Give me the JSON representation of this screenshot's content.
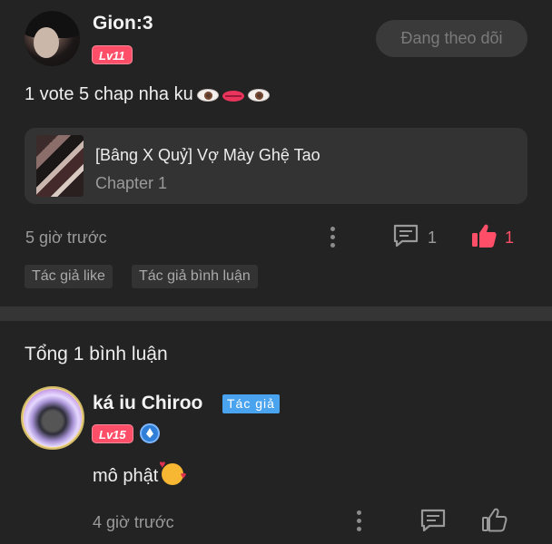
{
  "post": {
    "username": "Gion:3",
    "level": "Lv11",
    "follow_label": "Đang theo dõi",
    "text": "1 vote 5 chap nha ku",
    "emojis": [
      "eye-emoji",
      "lips-emoji",
      "eye-emoji"
    ],
    "card": {
      "title": "[Bâng X Quỷ] Vợ Mày Ghệ Tao",
      "subtitle": "Chapter 1"
    },
    "time": "5 giờ trước",
    "comment_count": "1",
    "like_count": "1",
    "tags": [
      "Tác giả like",
      "Tác giả bình luận"
    ]
  },
  "comments_section": {
    "total_label": "Tổng 1 bình luận",
    "comments": [
      {
        "name": "ká iu Chiroo",
        "author_badge": "Tác giả",
        "level": "Lv15",
        "text": "mô phật",
        "time": "4 giờ trước"
      }
    ]
  },
  "colors": {
    "background": "#232323",
    "accent_pink": "#ff4f68",
    "author_badge_blue": "#4aa3ee",
    "card_bg": "#333333"
  }
}
